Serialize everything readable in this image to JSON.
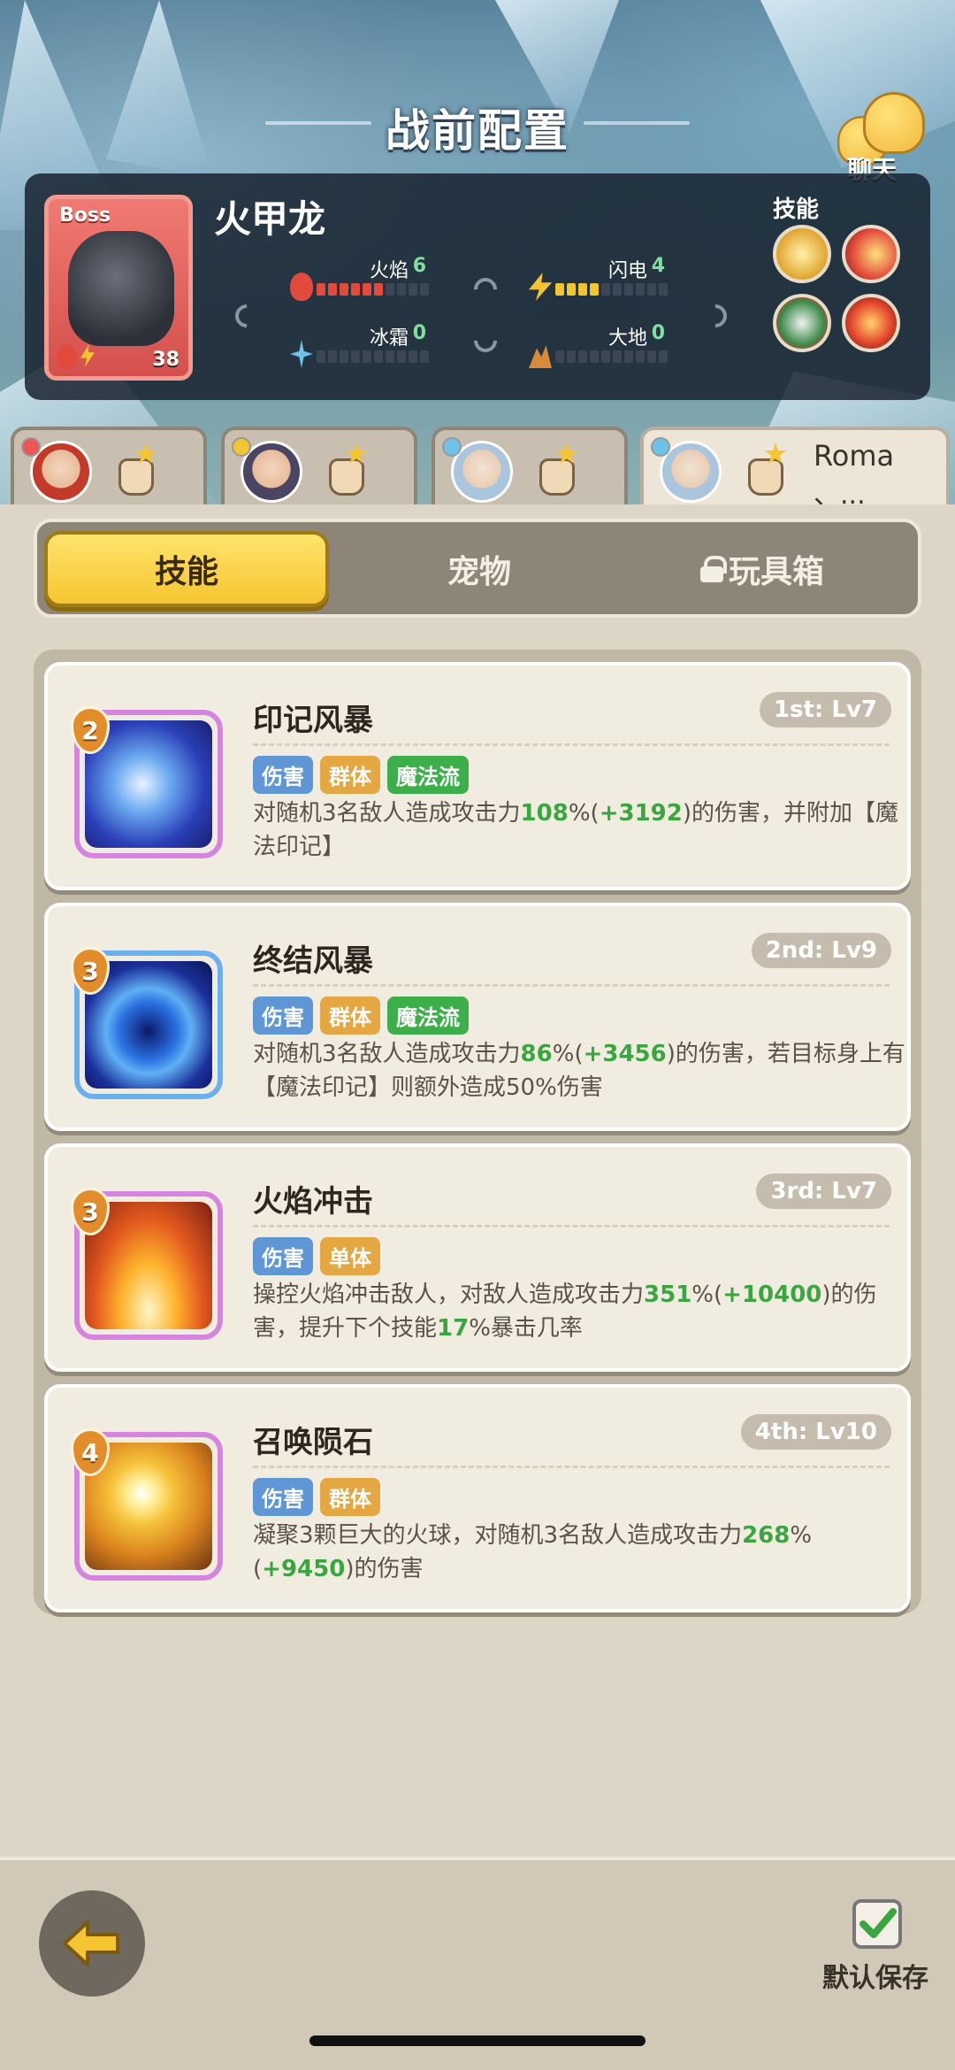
{
  "header": {
    "title": "战前配置",
    "chat_label": "聊天"
  },
  "boss": {
    "tag": "Boss",
    "level": "38",
    "name": "火甲龙",
    "stats": [
      {
        "label": "火焰",
        "value": "6",
        "color": "#e24a3b"
      },
      {
        "label": "闪电",
        "value": "4",
        "color": "#f2c531"
      },
      {
        "label": "冰霜",
        "value": "0",
        "color": "#6cc2e8"
      },
      {
        "label": "大地",
        "value": "0",
        "color": "#d98b3a"
      }
    ],
    "skills_label": "技能",
    "skill_icons": [
      "sun-orb-icon",
      "fire-swirl-icon",
      "storm-orb-icon",
      "explosion-icon"
    ]
  },
  "heroes": [
    {
      "name": "",
      "sub": ""
    },
    {
      "name": "",
      "sub": ""
    },
    {
      "name": "",
      "sub": ""
    },
    {
      "name": "Roma",
      "sub": "、..."
    }
  ],
  "tabs": {
    "skills": "技能",
    "pets": "宠物",
    "toybox": "玩具箱"
  },
  "skills": [
    {
      "badge": "2",
      "title": "印记风暴",
      "order": "1st: Lv7",
      "tags": [
        "伤害",
        "群体",
        "魔法流"
      ],
      "desc_parts": [
        "对随机3名敌人造成攻击力",
        "108",
        "%(",
        "+3192",
        ")的伤害，并附加【魔法印记】"
      ]
    },
    {
      "badge": "3",
      "title": "终结风暴",
      "order": "2nd: Lv9",
      "tags": [
        "伤害",
        "群体",
        "魔法流"
      ],
      "desc_parts": [
        "对随机3名敌人造成攻击力",
        "86",
        "%(",
        "+3456",
        ")的伤害，若目标身上有【魔法印记】则额外造成50%伤害"
      ]
    },
    {
      "badge": "3",
      "title": "火焰冲击",
      "order": "3rd: Lv7",
      "tags": [
        "伤害",
        "单体"
      ],
      "desc_parts": [
        "操控火焰冲击敌人，对敌人造成攻击力",
        "351",
        "%(",
        "+10400",
        ")的伤害，提升下个技能",
        "17",
        "%暴击几率"
      ]
    },
    {
      "badge": "4",
      "title": "召唤陨石",
      "order": "4th: Lv10",
      "tags": [
        "伤害",
        "群体"
      ],
      "desc_parts": [
        "凝聚3颗巨大的火球，对随机3名敌人造成攻击力",
        "268",
        "%(",
        "+9450",
        ")的伤害"
      ]
    }
  ],
  "footer": {
    "save_label": "默认保存"
  }
}
